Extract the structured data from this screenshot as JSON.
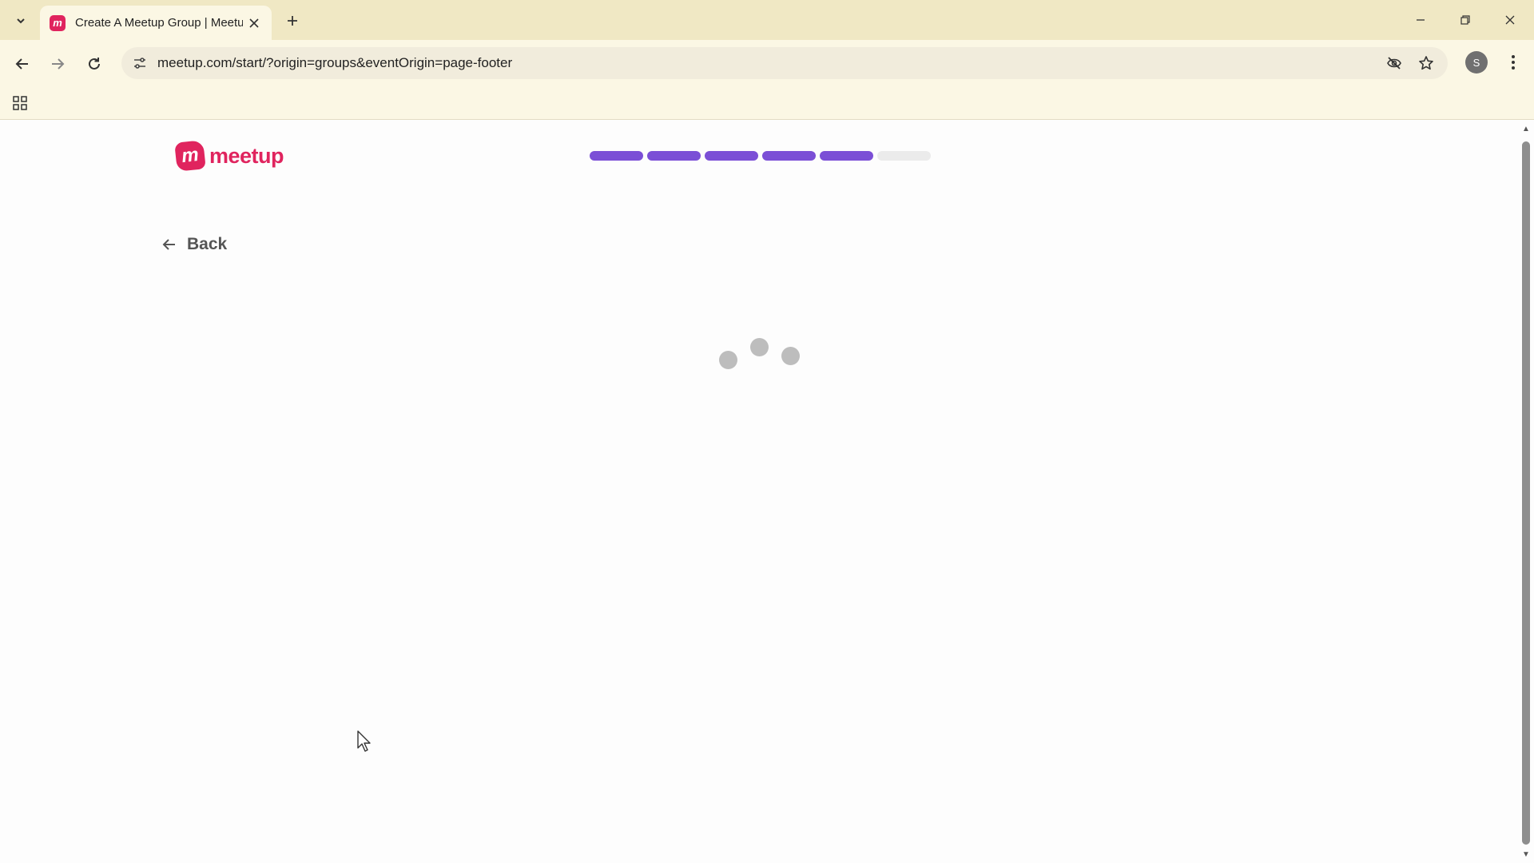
{
  "browser": {
    "tab_title": "Create A Meetup Group | Meetup",
    "url": "meetup.com/start/?origin=groups&eventOrigin=page-footer",
    "profile_initial": "S",
    "favicon_letter": "m"
  },
  "page": {
    "logo_text": "meetup",
    "logo_mark": "m",
    "back_label": "Back",
    "progress": {
      "total_steps": 6,
      "completed_steps": 5
    },
    "status": "loading"
  },
  "colors": {
    "brand": "#e0245e",
    "progress_active": "#7b4fd6",
    "progress_inactive": "#ebebeb",
    "chrome_bg": "#f0e8c4"
  }
}
